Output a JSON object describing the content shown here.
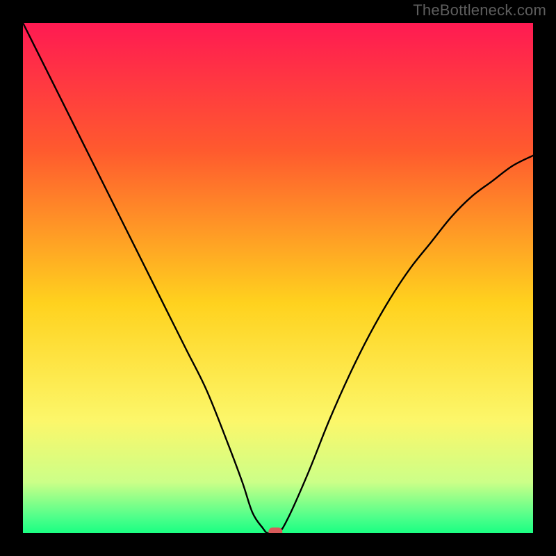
{
  "watermark": {
    "text": "TheBottleneck.com"
  },
  "chart_data": {
    "type": "line",
    "title": "",
    "xlabel": "",
    "ylabel": "",
    "xlim": [
      0,
      100
    ],
    "ylim": [
      0,
      100
    ],
    "grid": false,
    "legend": false,
    "background_gradient": {
      "stops": [
        {
          "offset": 0,
          "color": "#ff1a52"
        },
        {
          "offset": 25,
          "color": "#ff5a2e"
        },
        {
          "offset": 55,
          "color": "#ffd21e"
        },
        {
          "offset": 78,
          "color": "#fcf76a"
        },
        {
          "offset": 90,
          "color": "#ccff88"
        },
        {
          "offset": 97,
          "color": "#4dff8a"
        },
        {
          "offset": 100,
          "color": "#1aff82"
        }
      ]
    },
    "series": [
      {
        "name": "bottleneck-curve",
        "x": [
          0,
          4,
          8,
          12,
          16,
          20,
          24,
          28,
          32,
          36,
          40,
          43,
          45,
          47,
          48,
          50,
          52,
          56,
          60,
          64,
          68,
          72,
          76,
          80,
          84,
          88,
          92,
          96,
          100
        ],
        "y": [
          100,
          92,
          84,
          76,
          68,
          60,
          52,
          44,
          36,
          28,
          18,
          10,
          4,
          1,
          0,
          0,
          3,
          12,
          22,
          31,
          39,
          46,
          52,
          57,
          62,
          66,
          69,
          72,
          74
        ]
      }
    ],
    "marker": {
      "name": "target-marker",
      "x": 49.5,
      "y": 0,
      "color": "#d85a5a",
      "shape": "pill"
    }
  }
}
